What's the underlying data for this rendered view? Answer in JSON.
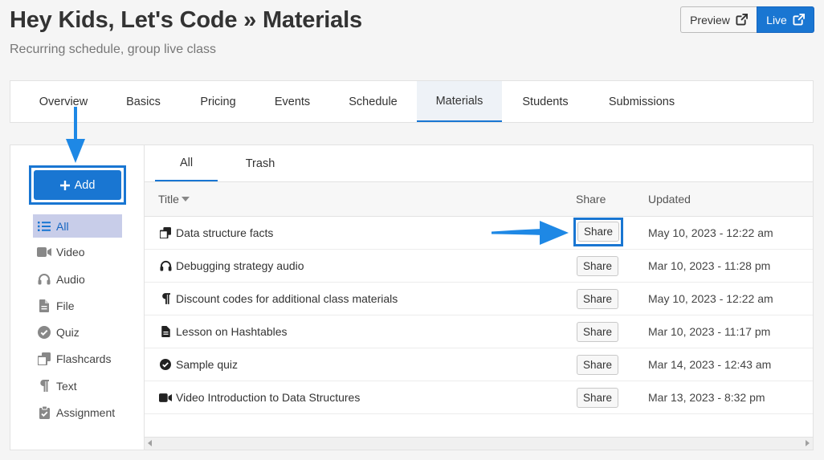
{
  "header": {
    "title": "Hey Kids, Let's Code » Materials",
    "subtitle": "Recurring schedule, group live class",
    "preview_label": "Preview",
    "live_label": "Live"
  },
  "tabs": [
    {
      "label": "Overview"
    },
    {
      "label": "Basics"
    },
    {
      "label": "Pricing"
    },
    {
      "label": "Events"
    },
    {
      "label": "Schedule"
    },
    {
      "label": "Materials",
      "active": true
    },
    {
      "label": "Students"
    },
    {
      "label": "Submissions"
    }
  ],
  "sidebar": {
    "add_label": "Add",
    "filters": [
      {
        "label": "All",
        "icon": "list-icon",
        "active": true
      },
      {
        "label": "Video",
        "icon": "video-icon"
      },
      {
        "label": "Audio",
        "icon": "headphones-icon"
      },
      {
        "label": "File",
        "icon": "file-icon"
      },
      {
        "label": "Quiz",
        "icon": "check-circle-icon"
      },
      {
        "label": "Flashcards",
        "icon": "flashcards-icon"
      },
      {
        "label": "Text",
        "icon": "paragraph-icon"
      },
      {
        "label": "Assignment",
        "icon": "clipboard-check-icon"
      }
    ]
  },
  "subtabs": [
    {
      "label": "All",
      "active": true
    },
    {
      "label": "Trash"
    }
  ],
  "table": {
    "columns": {
      "title": "Title",
      "share": "Share",
      "updated": "Updated"
    },
    "share_label": "Share",
    "rows": [
      {
        "title": "Data structure facts",
        "icon": "flashcards-icon",
        "updated": "May 10, 2023 - 12:22 am"
      },
      {
        "title": "Debugging strategy audio",
        "icon": "headphones-icon",
        "updated": "Mar 10, 2023 - 11:28 pm"
      },
      {
        "title": "Discount codes for additional class materials",
        "icon": "paragraph-icon",
        "updated": "May 10, 2023 - 12:22 am"
      },
      {
        "title": "Lesson on Hashtables",
        "icon": "file-icon",
        "updated": "Mar 10, 2023 - 11:17 pm"
      },
      {
        "title": "Sample quiz",
        "icon": "check-circle-icon",
        "updated": "Mar 14, 2023 - 12:43 am"
      },
      {
        "title": "Video Introduction to Data Structures",
        "icon": "video-icon",
        "updated": "Mar 13, 2023 - 8:32 pm"
      }
    ]
  },
  "colors": {
    "accent": "#1976d2",
    "active_filter_bg": "#c8cde9",
    "annotation_arrow": "#1e88e5"
  }
}
